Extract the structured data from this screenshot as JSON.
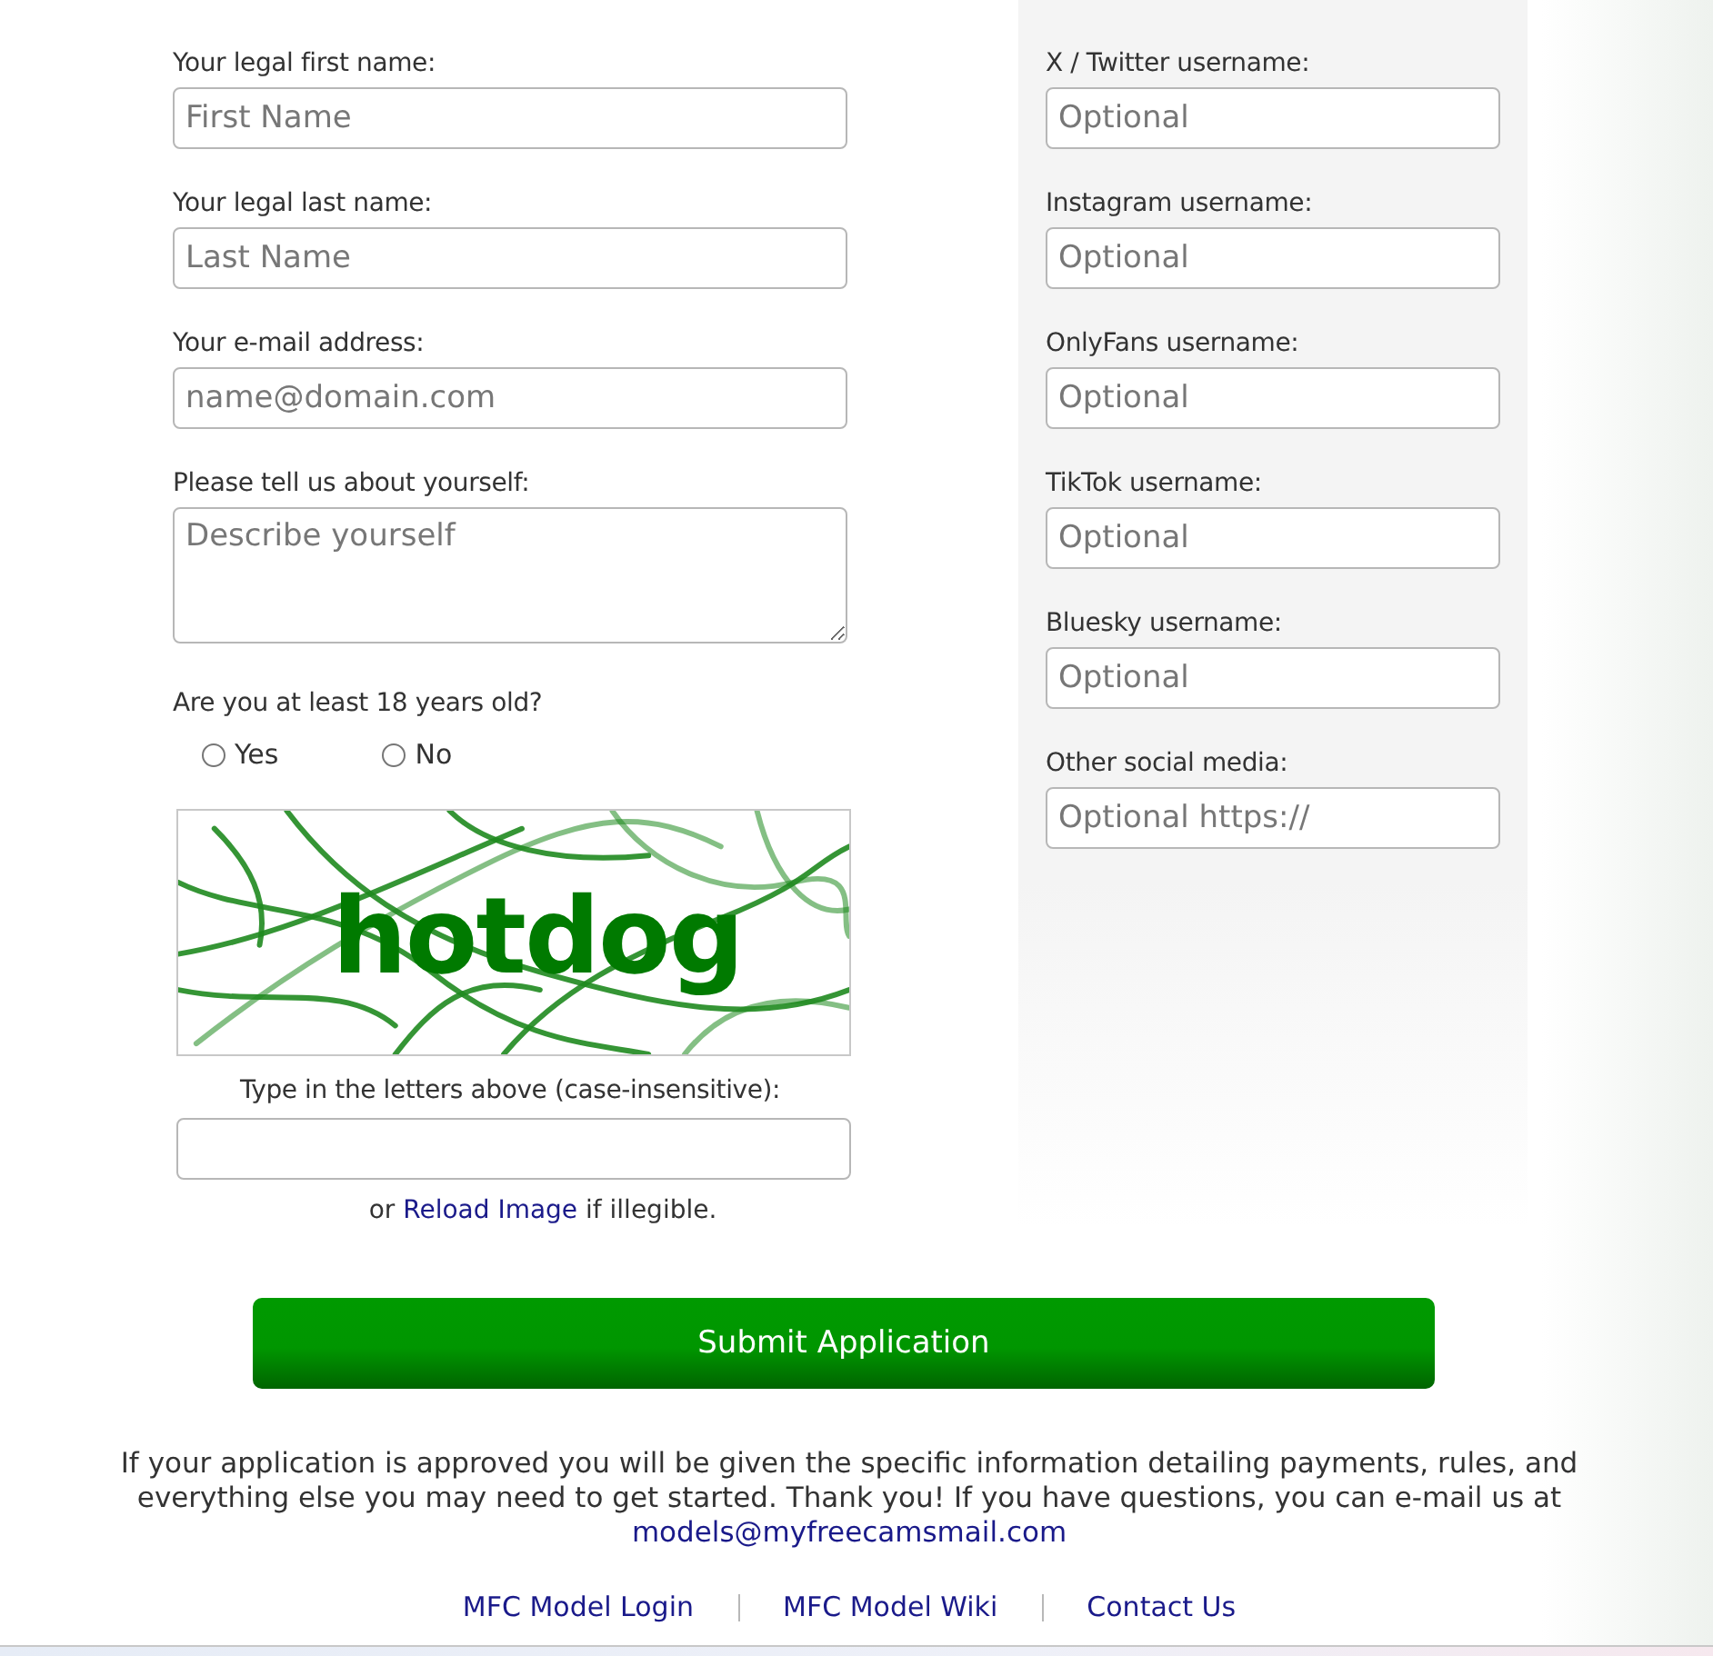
{
  "applicant_fields": [
    {
      "kind": "input",
      "label": "Your legal first name:",
      "placeholder": "First Name"
    },
    {
      "kind": "input",
      "label": "Your legal last name:",
      "placeholder": "Last Name"
    },
    {
      "kind": "input",
      "label": "Your e-mail address:",
      "placeholder": "name@domain.com"
    },
    {
      "kind": "textarea",
      "label": "Please tell us about yourself:",
      "placeholder": "Describe yourself"
    }
  ],
  "age_question": {
    "label": "Are you at least 18 years old?",
    "options": [
      {
        "label": "Yes",
        "selected": false
      },
      {
        "label": "No",
        "selected": false
      }
    ]
  },
  "captcha": {
    "text": "hotdog",
    "prompt": "Type in the letters above (case-insensitive):",
    "reload_note": {
      "before": "or",
      "link": "Reload Image",
      "after": "if illegible."
    }
  },
  "social_fields": [
    {
      "label": "X / Twitter username:",
      "placeholder": "Optional"
    },
    {
      "label": "Instagram username:",
      "placeholder": "Optional"
    },
    {
      "label": "OnlyFans username:",
      "placeholder": "Optional"
    },
    {
      "label": "TikTok username:",
      "placeholder": "Optional"
    },
    {
      "label": "Bluesky username:",
      "placeholder": "Optional"
    },
    {
      "label": "Other social media:",
      "placeholder": "Optional https://"
    }
  ],
  "submit_button": {
    "label": "Submit Application"
  },
  "notice": {
    "text": "If your application is approved you will be given the specific information detailing payments, rules, and everything else you may need to get started. Thank you! If you have questions, you can e-mail us at",
    "email": "models@myfreecamsmail.com"
  },
  "footer_links": [
    "MFC Model Login",
    "MFC Model Wiki",
    "Contact Us"
  ]
}
